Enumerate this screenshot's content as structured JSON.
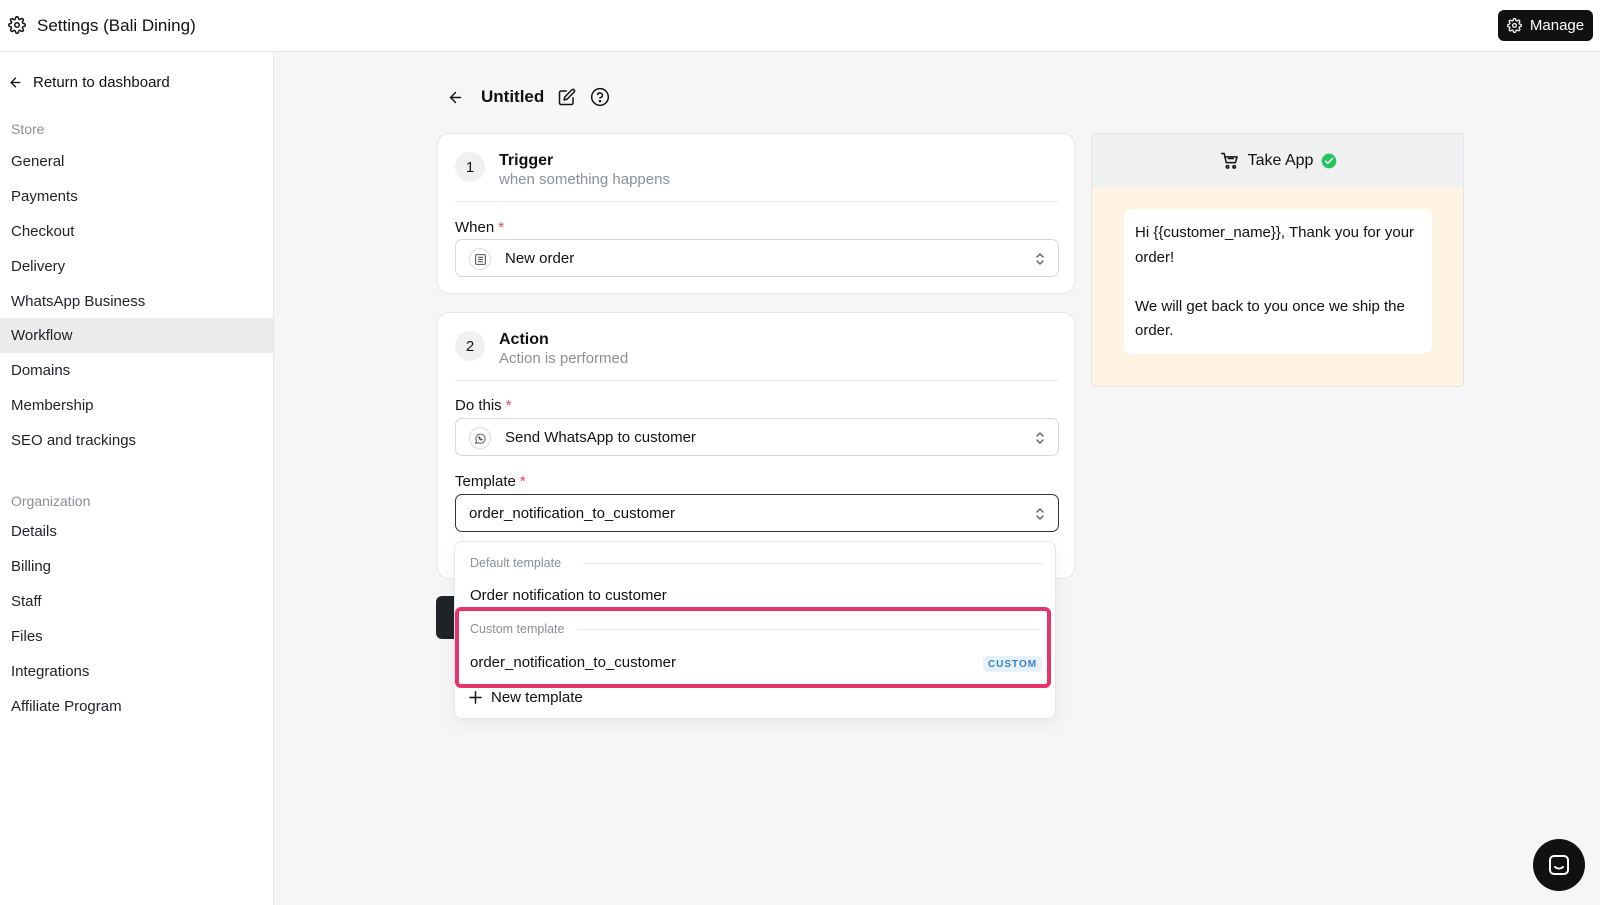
{
  "topbar": {
    "title": "Settings (Bali Dining)",
    "manage_label": "Manage"
  },
  "sidebar": {
    "return_label": "Return to dashboard",
    "store_label": "Store",
    "store_items": [
      "General",
      "Payments",
      "Checkout",
      "Delivery",
      "WhatsApp Business",
      "Workflow",
      "Domains",
      "Membership",
      "SEO and trackings"
    ],
    "active_item": "Workflow",
    "org_label": "Organization",
    "org_items": [
      "Details",
      "Billing",
      "Staff",
      "Files",
      "Integrations",
      "Affiliate Program"
    ]
  },
  "workflow": {
    "title": "Untitled",
    "trigger": {
      "number": "1",
      "title": "Trigger",
      "subtitle": "when something happens",
      "when_label": "When",
      "when_value": "New order"
    },
    "action": {
      "number": "2",
      "title": "Action",
      "subtitle": "Action is performed",
      "do_label": "Do this",
      "do_value": "Send WhatsApp to customer",
      "template_label": "Template",
      "template_value": "order_notification_to_customer"
    },
    "required_mark": "*"
  },
  "dropdown": {
    "default_group_label": "Default template",
    "default_option": "Order notification to customer",
    "custom_group_label": "Custom template",
    "custom_option": "order_notification_to_customer",
    "custom_badge": "CUSTOM",
    "new_template_label": "New template"
  },
  "preview": {
    "app_name": "Take App",
    "message_line1": "Hi {{customer_name}}, Thank you for your order!",
    "message_line2": "We will get back to you once we ship the order."
  },
  "colors": {
    "highlight": "#e8336b",
    "verified": "#22c55e",
    "preview_bg": "#fff3e4",
    "badge_text": "#3b82c4"
  }
}
